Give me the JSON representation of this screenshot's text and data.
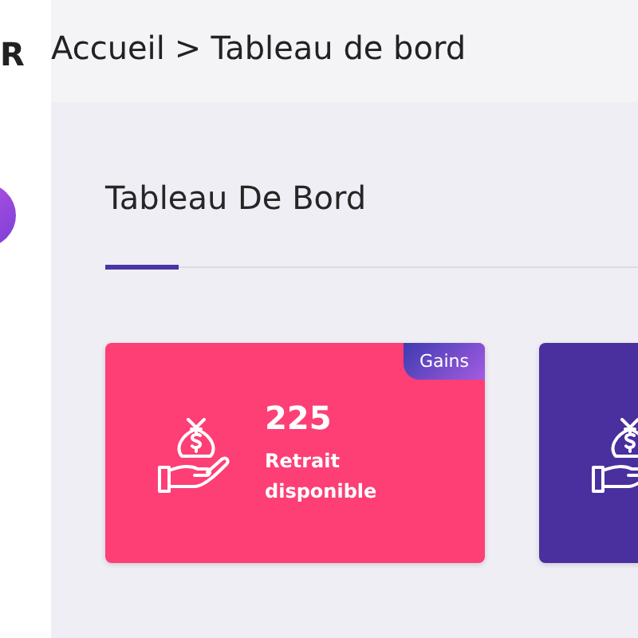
{
  "sidebar": {
    "logo_text": "R"
  },
  "breadcrumb": {
    "home": "Accueil",
    "separator": ">",
    "current": "Tableau de bord"
  },
  "panel": {
    "title": "Tableau De Bord"
  },
  "cards": [
    {
      "color": "#fd3f76",
      "value": "225",
      "label": "Retrait disponible",
      "badge": "Gains"
    },
    {
      "color": "#4a2f9f"
    }
  ]
}
